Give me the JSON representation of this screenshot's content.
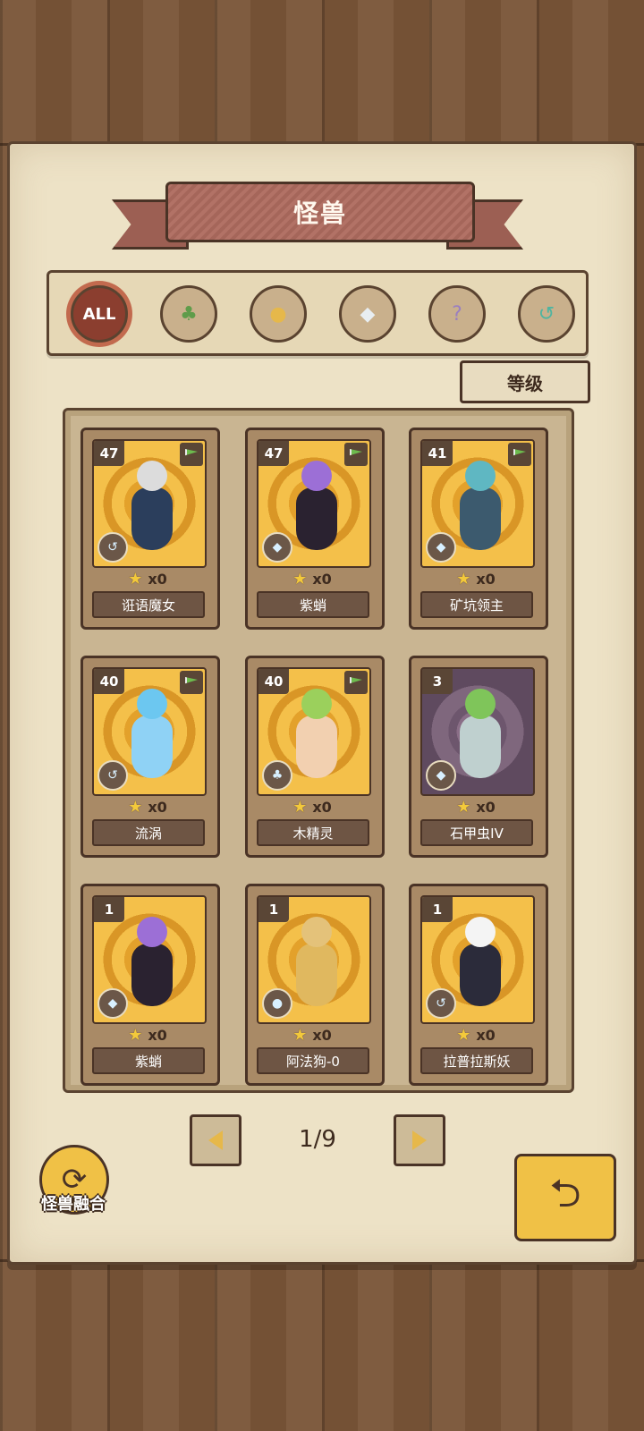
{
  "title": "怪兽",
  "filters": [
    {
      "label": "ALL",
      "icon": "all-text-icon",
      "active": true
    },
    {
      "label": "",
      "icon": "leaf-icon"
    },
    {
      "label": "",
      "icon": "paw-icon"
    },
    {
      "label": "",
      "icon": "crystal-icon"
    },
    {
      "label": "",
      "icon": "question-icon"
    },
    {
      "label": "",
      "icon": "rune-icon"
    }
  ],
  "sort_label": "等级",
  "monsters": [
    {
      "level": "47",
      "count": "x0",
      "name": "诳语魔女",
      "flag": true,
      "type": "rune",
      "bg": "gold"
    },
    {
      "level": "47",
      "count": "x0",
      "name": "紫蛸",
      "flag": true,
      "type": "crystal",
      "bg": "gold"
    },
    {
      "level": "41",
      "count": "x0",
      "name": "矿坑领主",
      "flag": true,
      "type": "crystal",
      "bg": "gold"
    },
    {
      "level": "40",
      "count": "x0",
      "name": "流涡",
      "flag": true,
      "type": "rune",
      "bg": "gold"
    },
    {
      "level": "40",
      "count": "x0",
      "name": "木精灵",
      "flag": true,
      "type": "leaf",
      "bg": "gold"
    },
    {
      "level": "3",
      "count": "x0",
      "name": "石甲虫IV",
      "flag": false,
      "type": "crystal",
      "bg": "purple"
    },
    {
      "level": "1",
      "count": "x0",
      "name": "紫蛸",
      "flag": false,
      "type": "crystal",
      "bg": "gold"
    },
    {
      "level": "1",
      "count": "x0",
      "name": "阿法狗-0",
      "flag": false,
      "type": "paw",
      "bg": "gold"
    },
    {
      "level": "1",
      "count": "x0",
      "name": "拉普拉斯妖",
      "flag": false,
      "type": "rune",
      "bg": "gold"
    }
  ],
  "pager": {
    "indicator": "1/9"
  },
  "fusion_label": "怪兽融合",
  "colors": {
    "accent": "#f0c146",
    "ribbon": "#a5665a",
    "paper": "#ede2c6"
  }
}
